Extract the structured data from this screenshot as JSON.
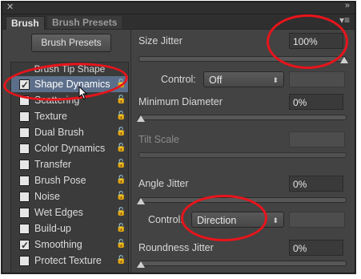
{
  "titlebar": {
    "close_glyph": "✕",
    "collapse_glyph": "»"
  },
  "tabs": [
    {
      "label": "Brush",
      "active": true
    },
    {
      "label": "Brush Presets",
      "active": false
    }
  ],
  "tab_menu_glyph": "▾≡",
  "brush_presets_button": "Brush Presets",
  "left_panel": {
    "header": "Brush Tip Shape",
    "items": [
      {
        "label": "Shape Dynamics",
        "checked": true,
        "selected": true
      },
      {
        "label": "Scattering",
        "checked": false
      },
      {
        "label": "Texture",
        "checked": false
      },
      {
        "label": "Dual Brush",
        "checked": false
      },
      {
        "label": "Color Dynamics",
        "checked": false
      },
      {
        "label": "Transfer",
        "checked": false
      },
      {
        "label": "Brush Pose",
        "checked": false
      },
      {
        "label": "Noise",
        "checked": false
      },
      {
        "label": "Wet Edges",
        "checked": false
      },
      {
        "label": "Build-up",
        "checked": false
      },
      {
        "label": "Smoothing",
        "checked": true
      },
      {
        "label": "Protect Texture",
        "checked": false
      }
    ],
    "lock_glyph": "🔓",
    "check_glyph": "✓"
  },
  "right_panel": {
    "size_jitter": {
      "label": "Size Jitter",
      "value": "100%"
    },
    "size_control": {
      "label": "Control:",
      "value": "Off"
    },
    "min_diameter": {
      "label": "Minimum Diameter",
      "value": "0%"
    },
    "tilt_scale": {
      "label": "Tilt Scale"
    },
    "angle_jitter": {
      "label": "Angle Jitter",
      "value": "0%"
    },
    "angle_control": {
      "label": "Control:",
      "value": "Direction"
    },
    "roundness_jitter": {
      "label": "Roundness Jitter",
      "value": "0%"
    }
  },
  "select_arrow_glyph": "⬍",
  "annotation_color": "#e8141b",
  "selection_color": "#5c6f8a"
}
